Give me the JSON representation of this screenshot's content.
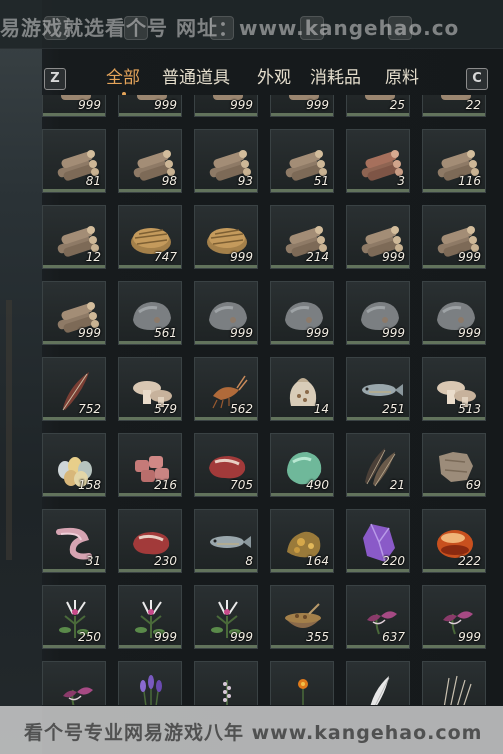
{
  "watermark_top": "易游戏就选看个号  网址：www.kangehao.co",
  "watermark_bottom": "看个号专业网易游戏八年  www.kangehao.com",
  "tabs": {
    "key_left": "Z",
    "key_right": "C",
    "items": [
      "全部",
      "普通道具",
      "外观",
      "消耗品",
      "原料"
    ],
    "active": "全部"
  },
  "colors": {
    "active_tab": "#e5a45a",
    "tab_text": "#e4ddcc",
    "cell_bar": "#62735c"
  },
  "rows": [
    {
      "items": [
        {
          "icon": "wood-icon",
          "count": "999"
        },
        {
          "icon": "wood-icon",
          "count": "999"
        },
        {
          "icon": "wood-icon",
          "count": "999"
        },
        {
          "icon": "wood-icon",
          "count": "999"
        },
        {
          "icon": "wood-icon",
          "count": "25"
        },
        {
          "icon": "wood-icon",
          "count": "22"
        }
      ]
    },
    {
      "items": [
        {
          "icon": "log-bundle-icon",
          "count": "81"
        },
        {
          "icon": "log-bundle-icon",
          "count": "98"
        },
        {
          "icon": "log-bundle-icon",
          "count": "93"
        },
        {
          "icon": "log-bundle-icon",
          "count": "51"
        },
        {
          "icon": "red-log-bundle-icon",
          "count": "3"
        },
        {
          "icon": "log-bundle-icon",
          "count": "116"
        }
      ]
    },
    {
      "items": [
        {
          "icon": "log-bundle-icon",
          "count": "12"
        },
        {
          "icon": "hay-icon",
          "count": "747"
        },
        {
          "icon": "hay-icon",
          "count": "999"
        },
        {
          "icon": "log-bundle-icon",
          "count": "214"
        },
        {
          "icon": "log-bundle-icon",
          "count": "999"
        },
        {
          "icon": "log-bundle-icon",
          "count": "999"
        }
      ]
    },
    {
      "items": [
        {
          "icon": "log-bundle-icon",
          "count": "999"
        },
        {
          "icon": "stone-icon",
          "count": "561"
        },
        {
          "icon": "stone-icon",
          "count": "999"
        },
        {
          "icon": "stone-icon",
          "count": "999"
        },
        {
          "icon": "stone-icon",
          "count": "999"
        },
        {
          "icon": "stone-icon",
          "count": "999"
        }
      ]
    },
    {
      "items": [
        {
          "icon": "feather-icon",
          "count": "752"
        },
        {
          "icon": "mushroom-icon",
          "count": "579"
        },
        {
          "icon": "shrimp-icon",
          "count": "562"
        },
        {
          "icon": "grain-sack-icon",
          "count": "14"
        },
        {
          "icon": "fish-icon",
          "count": "251"
        },
        {
          "icon": "mushroom-icon",
          "count": "513"
        }
      ]
    },
    {
      "items": [
        {
          "icon": "eggs-icon",
          "count": "158"
        },
        {
          "icon": "meat-chunks-icon",
          "count": "216"
        },
        {
          "icon": "steak-icon",
          "count": "705"
        },
        {
          "icon": "jade-icon",
          "count": "490"
        },
        {
          "icon": "feathers-icon",
          "count": "21"
        },
        {
          "icon": "hide-icon",
          "count": "69"
        }
      ]
    },
    {
      "items": [
        {
          "icon": "tendon-icon",
          "count": "31"
        },
        {
          "icon": "steak-icon",
          "count": "230"
        },
        {
          "icon": "fish-icon",
          "count": "8"
        },
        {
          "icon": "ore-icon",
          "count": "164"
        },
        {
          "icon": "amethyst-icon",
          "count": "220"
        },
        {
          "icon": "red-gem-icon",
          "count": "222"
        }
      ]
    },
    {
      "items": [
        {
          "icon": "herb-flower-icon",
          "count": "250"
        },
        {
          "icon": "herb-flower-icon",
          "count": "999"
        },
        {
          "icon": "herb-flower-icon",
          "count": "999"
        },
        {
          "icon": "seed-bowl-icon",
          "count": "355"
        },
        {
          "icon": "purple-flower-icon",
          "count": "637"
        },
        {
          "icon": "purple-flower-icon",
          "count": "999"
        }
      ]
    },
    {
      "items": [
        {
          "icon": "purple-flower-icon",
          "count": ""
        },
        {
          "icon": "lavender-icon",
          "count": ""
        },
        {
          "icon": "herb-sprig-icon",
          "count": ""
        },
        {
          "icon": "orange-flower-icon",
          "count": ""
        },
        {
          "icon": "white-feather-icon",
          "count": ""
        },
        {
          "icon": "dry-grass-icon",
          "count": ""
        }
      ]
    }
  ]
}
